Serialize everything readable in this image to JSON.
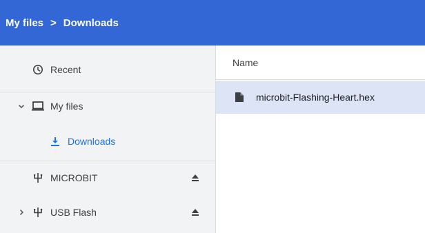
{
  "breadcrumb": {
    "root": "My files",
    "separator": ">",
    "current": "Downloads"
  },
  "sidebar": {
    "items": [
      {
        "label": "Recent",
        "icon": "clock-icon"
      },
      {
        "label": "My files",
        "icon": "laptop-icon",
        "expanded": true
      },
      {
        "label": "Downloads",
        "icon": "download-icon",
        "selected": true
      },
      {
        "label": "MICROBIT",
        "icon": "usb-icon",
        "ejectable": true
      },
      {
        "label": "USB Flash",
        "icon": "usb-icon",
        "ejectable": true,
        "expanded": false
      }
    ]
  },
  "file_list": {
    "column_name": "Name",
    "files": [
      {
        "name": "microbit-Flashing-Heart.hex",
        "icon": "file-icon",
        "selected": true
      }
    ]
  },
  "colors": {
    "header": "#3367d6",
    "accent": "#1a73e8",
    "sidebar_bg": "#f1f3f4",
    "selected_row": "#dce4f5"
  }
}
